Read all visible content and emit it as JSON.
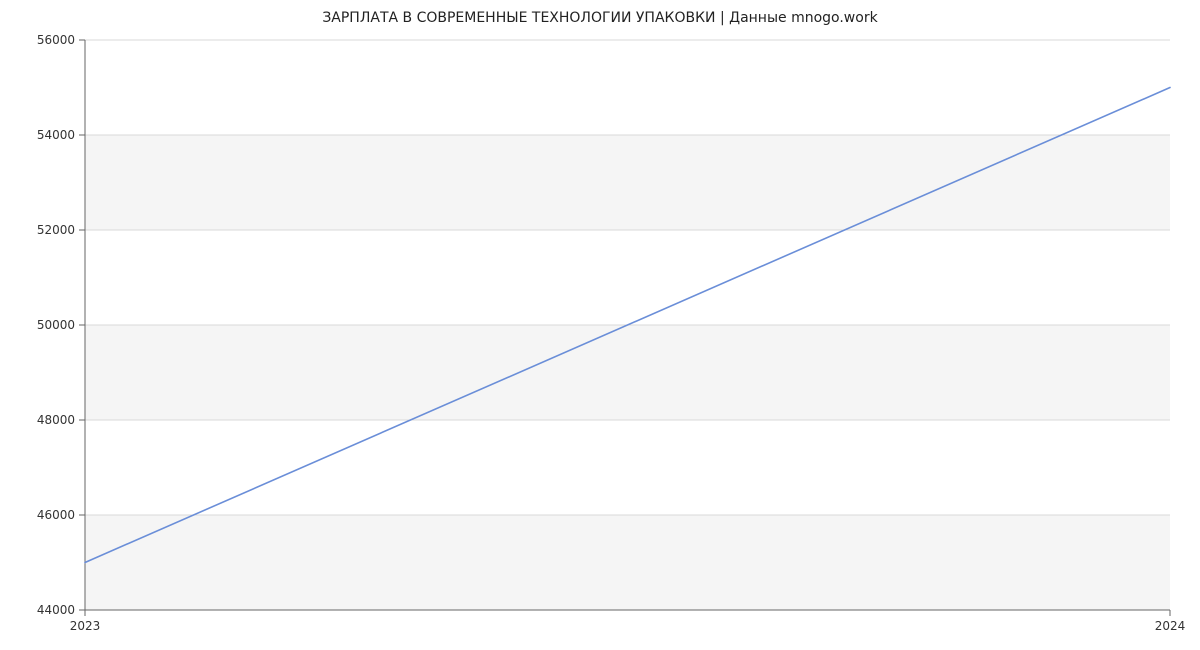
{
  "chart_data": {
    "type": "line",
    "title": "ЗАРПЛАТА В СОВРЕМЕННЫЕ ТЕХНОЛОГИИ УПАКОВКИ | Данные mnogo.work",
    "x": [
      2023,
      2024
    ],
    "values": [
      45000,
      55000
    ],
    "xlabel": "",
    "ylabel": "",
    "xlim": [
      2023,
      2024
    ],
    "ylim": [
      44000,
      56000
    ],
    "y_ticks": [
      44000,
      46000,
      48000,
      50000,
      52000,
      54000,
      56000
    ],
    "x_ticks": [
      2023,
      2024
    ],
    "line_color": "#6a8ed8",
    "grid": true
  }
}
